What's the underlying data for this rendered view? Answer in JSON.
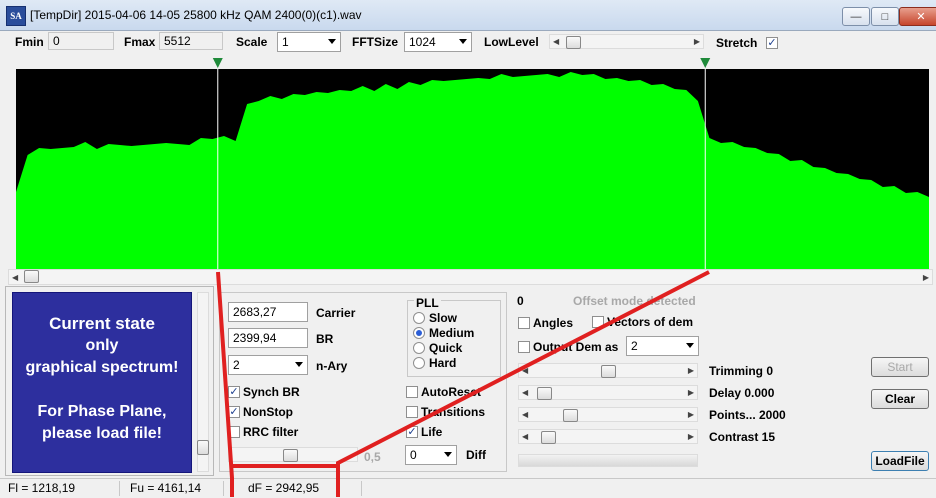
{
  "window": {
    "title": "[TempDir] 2015-04-06 14-05 25800 kHz QAM 2400(0)(c1).wav",
    "app_icon_text": "SA"
  },
  "toolbar": {
    "fmin_label": "Fmin",
    "fmin_value": "0",
    "fmax_label": "Fmax",
    "fmax_value": "5512",
    "scale_label": "Scale",
    "scale_value": "1",
    "fftsize_label": "FFTSize",
    "fftsize_value": "1024",
    "lowlevel_label": "LowLevel",
    "stretch_label": "Stretch",
    "stretch_checked": true
  },
  "state_panel": {
    "line1": "Current state",
    "line2": "only",
    "line3": "graphical spectrum!",
    "line4": "For Phase Plane,",
    "line5": "please load file!"
  },
  "params": {
    "carrier_value": "2683,27",
    "carrier_label": "Carrier",
    "br_value": "2399,94",
    "br_label": "BR",
    "nary_value": "2",
    "nary_label": "n-Ary",
    "synch_br_label": "Synch BR",
    "nonstop_label": "NonStop",
    "rrc_label": "RRC filter",
    "rrc_value": "0,5"
  },
  "pll": {
    "title": "PLL",
    "options": [
      "Slow",
      "Medium",
      "Quick",
      "Hard"
    ],
    "selected": "Medium"
  },
  "flags": {
    "autoreset_label": "AutoReset",
    "transitions_label": "Transitions",
    "life_label": "Life",
    "diff_value": "0",
    "diff_label": "Diff"
  },
  "demod": {
    "offset_value": "0",
    "offset_text": "Offset mode detected",
    "angles_label": "Angles",
    "vectors_label": "Vectors of dem",
    "output_label": "Output Dem as",
    "output_value": "2",
    "trimming_label": "Trimming 0",
    "delay_label": "Delay  0.000",
    "points_label": "Points... 2000",
    "contrast_label": "Contrast 15"
  },
  "buttons": {
    "start": "Start",
    "clear": "Clear",
    "loadfile": "LoadFile"
  },
  "status": {
    "fl": "Fl = 1218,19",
    "fu": "Fu = 4161,14",
    "df": "dF = 2942,95"
  },
  "colors": {
    "spectrum": "#00ff00",
    "background": "#000000",
    "overlay_line": "#e02020",
    "state_panel": "#2d2f9e"
  },
  "chart_data": {
    "type": "area",
    "series": [
      {
        "values": [
          38,
          58,
          60,
          61,
          60,
          62,
          63,
          61,
          62,
          63,
          61,
          63,
          62,
          64,
          62,
          63,
          65,
          66,
          66,
          65,
          82,
          85,
          86,
          86,
          87,
          88,
          88,
          89,
          89,
          90,
          91,
          90,
          92,
          91,
          93,
          93,
          94,
          95,
          94,
          96,
          95,
          96,
          97,
          97,
          96,
          98,
          97,
          97,
          98,
          98,
          97,
          96,
          95,
          95,
          94,
          93,
          92,
          91,
          89,
          85,
          65,
          64,
          63,
          62,
          60,
          59,
          57,
          55,
          54,
          52,
          50,
          49,
          47,
          46,
          44,
          42,
          41,
          39,
          38,
          37
        ]
      }
    ],
    "markers": [
      {
        "label": "Fl",
        "value": 1218.19
      },
      {
        "label": "Fu",
        "value": 4161.14
      }
    ],
    "xlim": [
      0,
      5512
    ]
  }
}
